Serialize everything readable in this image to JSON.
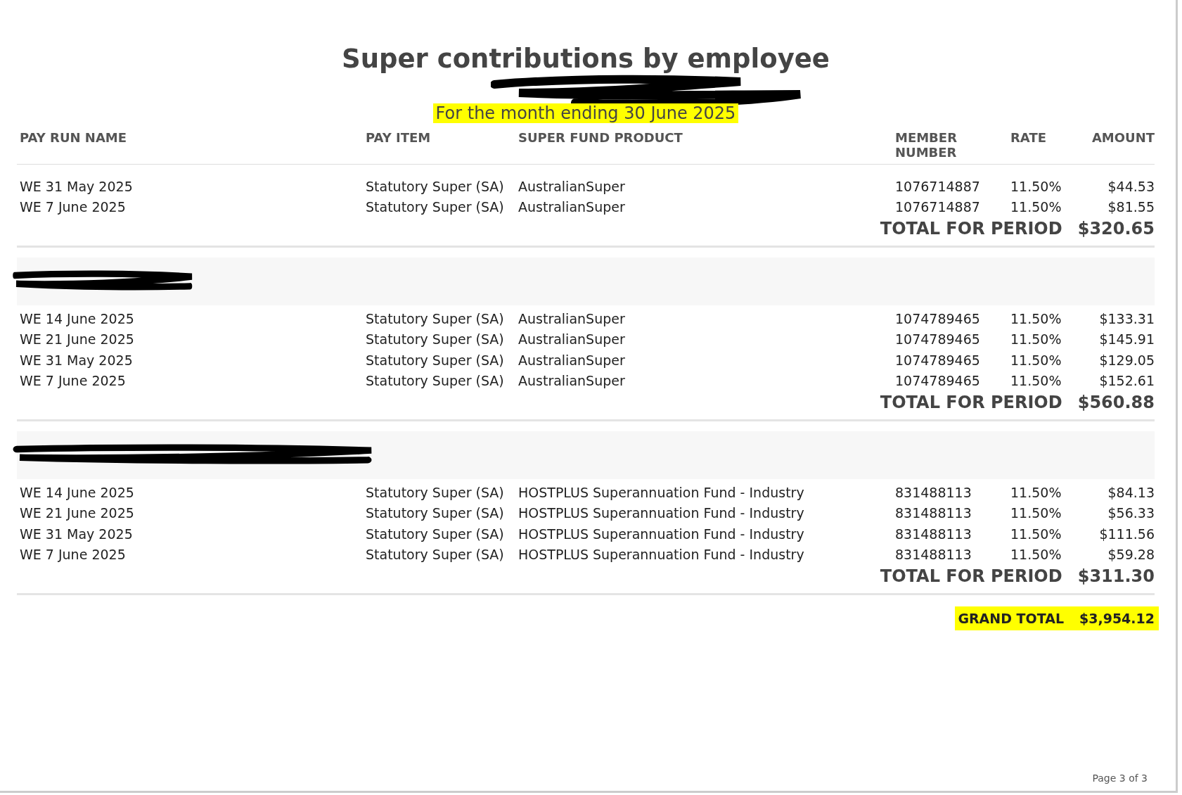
{
  "report": {
    "title": "Super contributions by employee",
    "company": {
      "redacted": true
    },
    "period": {
      "text": "For the month ending 30 June 2025",
      "highlighted": true
    }
  },
  "columns": [
    {
      "label": "PAY RUN NAME"
    },
    {
      "label": "PAY ITEM"
    },
    {
      "label": "SUPER FUND PRODUCT"
    },
    {
      "label": "MEMBER NUMBER"
    },
    {
      "label": "RATE"
    },
    {
      "label": "AMOUNT"
    }
  ],
  "sections": [
    {
      "rows": [
        [
          "WE 31 May 2025",
          "Statutory Super (SA)",
          "AustralianSuper",
          "1076714887",
          "11.50%",
          "$44.53"
        ],
        [
          "WE 7 June 2025",
          "Statutory Super (SA)",
          "AustralianSuper",
          "1076714887",
          "11.50%",
          "$81.55"
        ]
      ],
      "total_label": "TOTAL FOR PERIOD",
      "total": "$320.65"
    },
    {
      "header": {
        "redacted": true
      },
      "rows": [
        [
          "WE 14 June 2025",
          "Statutory Super (SA)",
          "AustralianSuper",
          "1074789465",
          "11.50%",
          "$133.31"
        ],
        [
          "WE 21 June 2025",
          "Statutory Super (SA)",
          "AustralianSuper",
          "1074789465",
          "11.50%",
          "$145.91"
        ],
        [
          "WE 31 May 2025",
          "Statutory Super (SA)",
          "AustralianSuper",
          "1074789465",
          "11.50%",
          "$129.05"
        ],
        [
          "WE 7 June 2025",
          "Statutory Super (SA)",
          "AustralianSuper",
          "1074789465",
          "11.50%",
          "$152.61"
        ]
      ],
      "total_label": "TOTAL FOR PERIOD",
      "total": "$560.88"
    },
    {
      "header": {
        "redacted": true
      },
      "rows": [
        [
          "WE 14 June 2025",
          "Statutory Super (SA)",
          "HOSTPLUS Superannuation Fund - Industry",
          "831488113",
          "11.50%",
          "$84.13"
        ],
        [
          "WE 21 June 2025",
          "Statutory Super (SA)",
          "HOSTPLUS Superannuation Fund - Industry",
          "831488113",
          "11.50%",
          "$56.33"
        ],
        [
          "WE 31 May 2025",
          "Statutory Super (SA)",
          "HOSTPLUS Superannuation Fund - Industry",
          "831488113",
          "11.50%",
          "$111.56"
        ],
        [
          "WE 7 June 2025",
          "Statutory Super (SA)",
          "HOSTPLUS Superannuation Fund - Industry",
          "831488113",
          "11.50%",
          "$59.28"
        ]
      ],
      "total_label": "TOTAL FOR PERIOD",
      "total": "$311.30"
    }
  ],
  "grand_total": {
    "label": "GRAND TOTAL",
    "value": "$3,954.12",
    "highlighted": true
  },
  "footer": {
    "page": "Page 3 of 3"
  }
}
